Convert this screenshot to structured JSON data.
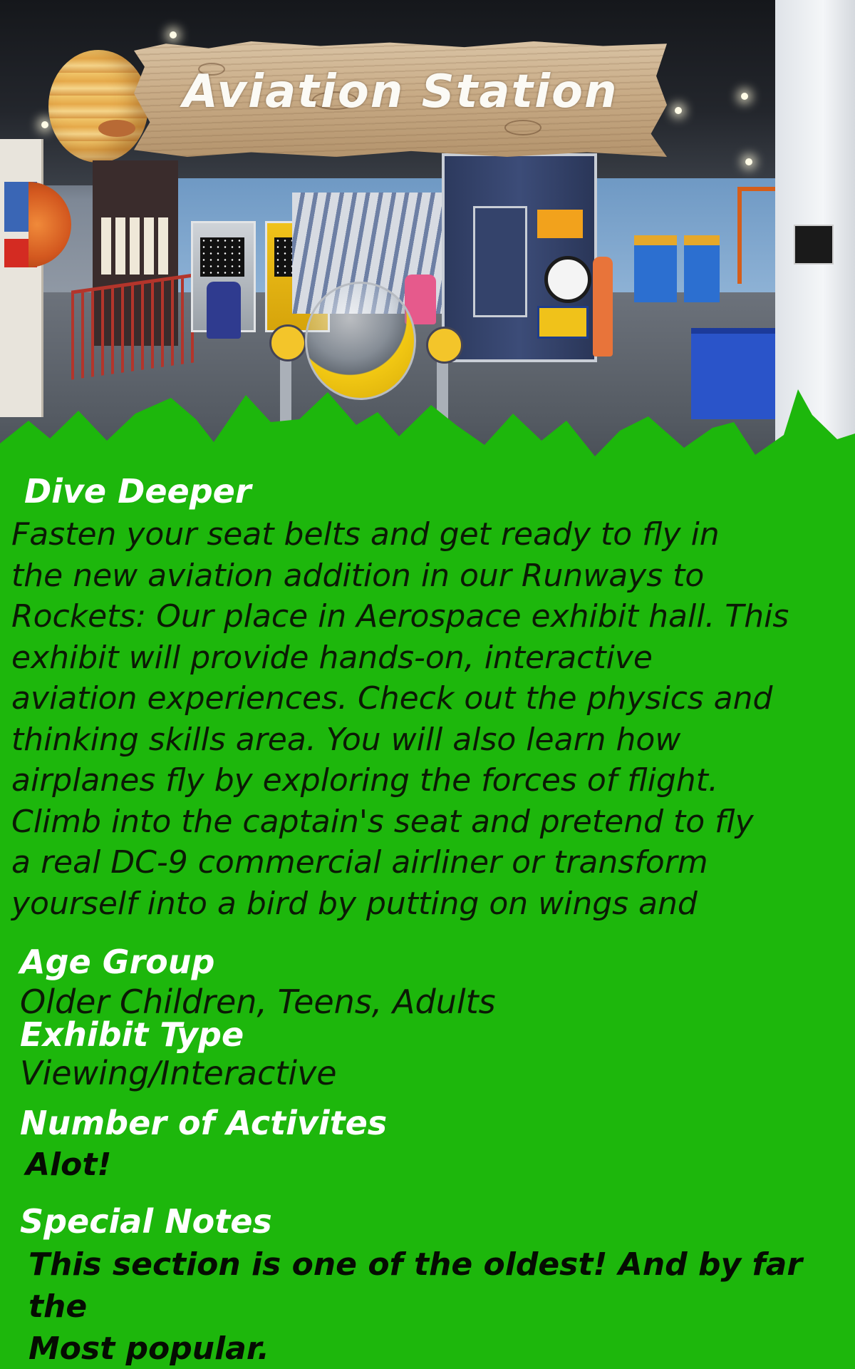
{
  "header": {
    "title": "Aviation Station"
  },
  "sections": {
    "dive_deeper": {
      "heading": "Dive Deeper",
      "lines": [
        "Fasten your seat belts and get ready to fly in",
        "the new aviation addition in our Runways to",
        "Rockets: Our place in Aerospace exhibit hall. This",
        "exhibit will provide hands-on, interactive",
        "aviation experiences. Check out the physics and",
        "thinking skills area. You will also learn how",
        "airplanes fly by exploring the forces of flight.",
        "Climb into the captain's seat and pretend to fly",
        "a real DC-9 commercial airliner or transform",
        "yourself into a bird by putting on wings and"
      ]
    },
    "age_group": {
      "heading": "Age Group",
      "value": "Older Children, Teens, Adults"
    },
    "exhibit_type": {
      "heading": "Exhibit Type",
      "value": "Viewing/Interactive"
    },
    "number_of_activities": {
      "heading": "Number of Activites",
      "value": "Alot!"
    },
    "special_notes": {
      "heading": "Special Notes",
      "lines": [
        "This section is one of the oldest! And by far the",
        "Most popular."
      ]
    }
  },
  "colors": {
    "background_green": "#1db70c",
    "heading_text": "#ffffff",
    "body_text": "#0b1a05",
    "sign_wood": "#c8ab86"
  }
}
